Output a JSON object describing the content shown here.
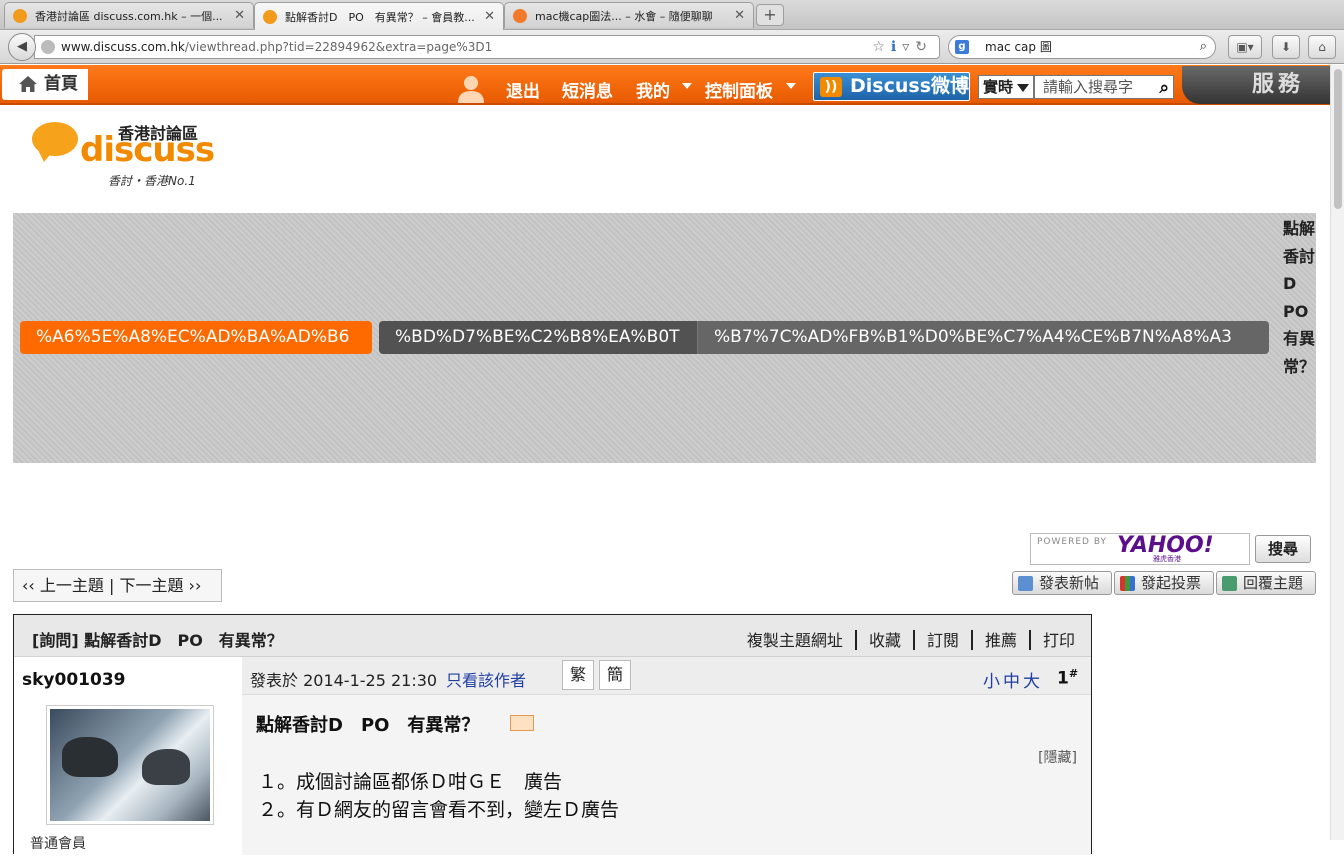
{
  "browser": {
    "tabs": [
      {
        "title": "香港討論區 discuss.com.hk – 一個...",
        "favicon_color": "#f29a1c"
      },
      {
        "title": "點解香討D　PO　有異常？ – 會員教...",
        "favicon_color": "#f29a1c"
      },
      {
        "title": "mac機cap圖法... – 水會 – 隨便聊聊",
        "favicon_color": "#f47a2a"
      }
    ],
    "new_tab_label": "+",
    "url_host": "www.discuss.com.hk",
    "url_path": "/viewthread.php?tid=22894962&extra=page%3D1",
    "search_value": "mac cap 圖",
    "search_engine_letter": "g"
  },
  "site": {
    "home_label": "首頁",
    "nav": {
      "logout": "退出",
      "messages": "短消息",
      "mine": "我的",
      "control_panel": "控制面板"
    },
    "weibo_label": "Discuss微博",
    "realtime_select": "實時",
    "search_placeholder": "請輸入搜尋字",
    "service_label": "服務",
    "logo": {
      "cn": "香港討論區",
      "en": "discuss",
      "slogan": "香討・香港No.1"
    },
    "brand_color": "#ff6a00"
  },
  "breadcrumb": {
    "items": [
      "%A6%5E%A8%EC%AD%BA%AD%B6",
      "%BD%D7%BE%C2%B8%EA%B0T",
      "%B7%7C%AD%FB%B1%D0%BE%C7%A4%CE%B7N%A8%A3"
    ],
    "current_title": "點解香討D　PO　有異常？"
  },
  "yahoo": {
    "powered_by": "POWERED BY",
    "brand": "YAHOO!",
    "sub": "雅虎香港",
    "search_button": "搜尋"
  },
  "thread_nav": {
    "prev": "‹‹ 上一主題",
    "separator": "|",
    "next": "下一主題 ››"
  },
  "actions": {
    "new_post": "發表新帖",
    "new_poll": "發起投票",
    "reply": "回覆主題"
  },
  "thread": {
    "title": "[詢問] 點解香討D　PO　有異常？",
    "links": [
      "複製主題網址",
      "收藏",
      "訂閱",
      "推薦",
      "打印"
    ],
    "post": {
      "author": "sky001039",
      "rank": "普通會員",
      "posted_at": "發表於 2014-1-25 21:30",
      "only_author": "只看該作者",
      "trad_btn": "繁",
      "simp_btn": "簡",
      "font_sizes": "小中大",
      "floor": "1",
      "floor_mark": "#",
      "subject": "點解香討D　PO　有異常？",
      "hide_label": "[隱藏]",
      "lines": [
        "１。成個討論區都係Ｄ咁ＧＥ　廣告",
        "２。有Ｄ網友的留言會看不到，變左Ｄ廣告"
      ]
    }
  }
}
